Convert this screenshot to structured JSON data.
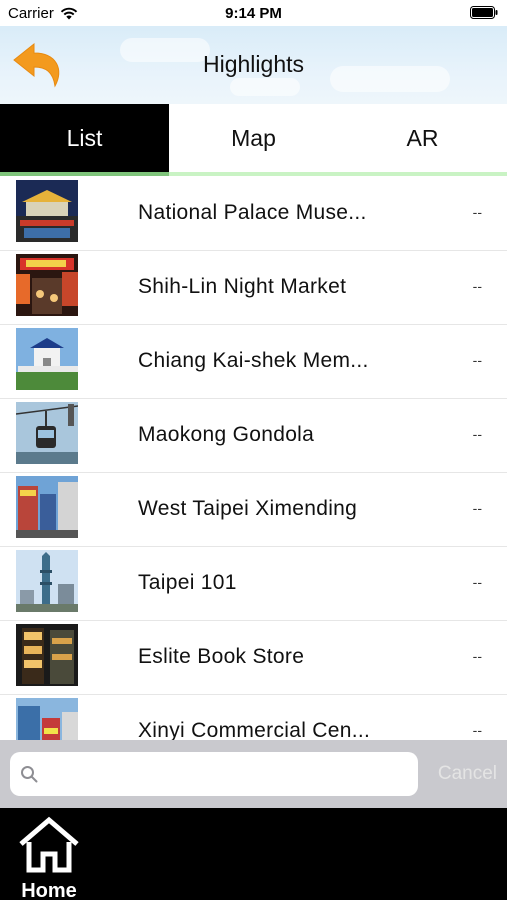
{
  "status_bar": {
    "carrier": "Carrier",
    "time": "9:14 PM"
  },
  "header": {
    "title": "Highlights",
    "back_icon": "undo-arrow-icon",
    "accent_color": "#f39a1e"
  },
  "tabs": [
    {
      "label": "List",
      "active": true
    },
    {
      "label": "Map",
      "active": false
    },
    {
      "label": "AR",
      "active": false
    }
  ],
  "list": {
    "items": [
      {
        "label": "National Palace Muse...",
        "value": "--",
        "thumb": "palace-photo"
      },
      {
        "label": "Shih-Lin Night Market",
        "value": "--",
        "thumb": "night-market-photo"
      },
      {
        "label": "Chiang Kai-shek Mem...",
        "value": "--",
        "thumb": "memorial-photo"
      },
      {
        "label": "Maokong Gondola",
        "value": "--",
        "thumb": "gondola-photo"
      },
      {
        "label": "West Taipei Ximending",
        "value": "--",
        "thumb": "ximending-photo"
      },
      {
        "label": "Taipei 101",
        "value": "--",
        "thumb": "taipei101-photo"
      },
      {
        "label": "Eslite Book Store",
        "value": "--",
        "thumb": "bookstore-photo"
      },
      {
        "label": "Xinyi Commercial Cen...",
        "value": "--",
        "thumb": "xinyi-photo"
      }
    ]
  },
  "search": {
    "placeholder": "",
    "value": "",
    "cancel_label": "Cancel"
  },
  "bottom_nav": {
    "home_label": "Home",
    "home_icon": "house-icon"
  }
}
